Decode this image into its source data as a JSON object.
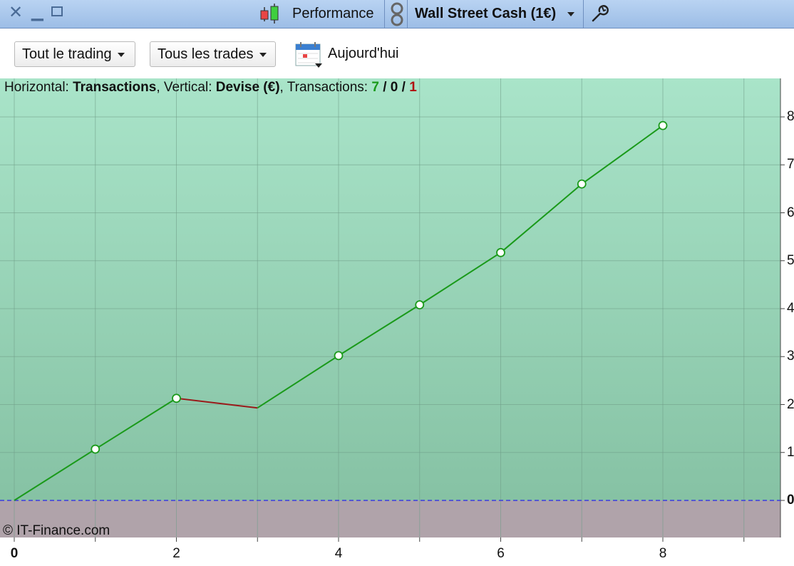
{
  "titlebar": {
    "title": "Performance",
    "instrument": "Wall Street Cash (1€)",
    "icons": [
      "close-icon",
      "minimize-icon",
      "maximize-icon",
      "candlestick-icon",
      "link-icon",
      "wrench-icon"
    ]
  },
  "toolbar": {
    "filter1": "Tout le trading",
    "filter2": "Tous les trades",
    "date_label": "Aujourd'hui",
    "icons": [
      "calendar-icon"
    ]
  },
  "header": {
    "horizontal_prefix": "Horizontal: ",
    "horizontal_value": "Transactions",
    "vertical_prefix": ", Vertical: ",
    "vertical_value": "Devise (€)",
    "transactions_prefix": ", Transactions: ",
    "count_win": "7",
    "slash1": " / ",
    "count_neutral": "0",
    "slash2": " / ",
    "count_loss": "1"
  },
  "copyright": "© IT-Finance.com",
  "colors": {
    "bg_top": "#a9e4c9",
    "bg_bottom": "#86c2a4",
    "negative_zone": "#b0a3aa",
    "gain_line": "#1a9a1a",
    "loss_line": "#9a1a1a",
    "zero_line": "#3a3ae0"
  },
  "chart_data": {
    "type": "line",
    "title": "",
    "xlabel": "Transactions",
    "ylabel": "Devise (€)",
    "x": [
      0,
      1,
      2,
      3,
      4,
      5,
      6,
      7,
      8
    ],
    "y": [
      0,
      1.07,
      2.13,
      1.93,
      3.02,
      4.08,
      5.17,
      6.6,
      7.82
    ],
    "segment_result": [
      "gain",
      "gain",
      "loss",
      "gain",
      "gain",
      "gain",
      "gain",
      "gain"
    ],
    "xlim": [
      0,
      9.5
    ],
    "ylim": [
      -0.8,
      8.6
    ],
    "x_ticks": [
      "0",
      "2",
      "4",
      "6",
      "8"
    ],
    "y_ticks": [
      "0",
      "1",
      "2",
      "3",
      "4",
      "5",
      "6",
      "7",
      "8"
    ],
    "grid": true
  }
}
